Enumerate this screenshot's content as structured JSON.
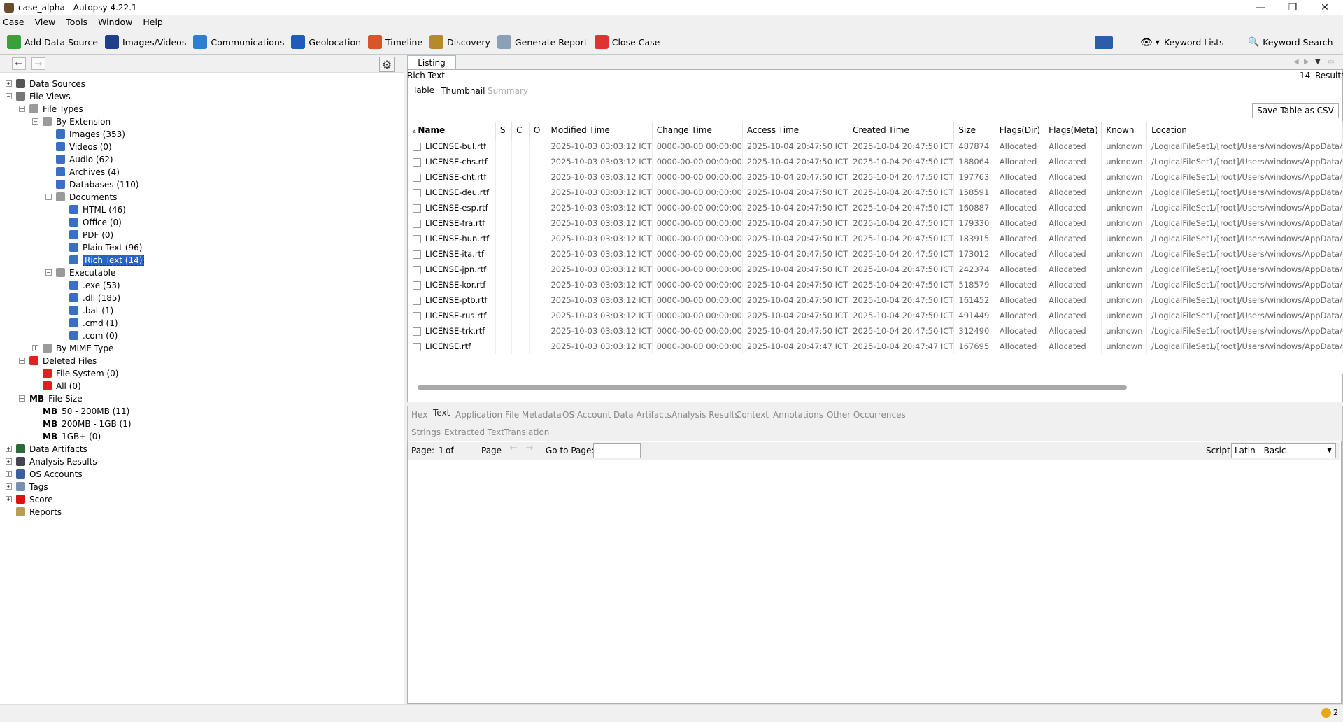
{
  "window": {
    "title": "case_alpha - Autopsy 4.22.1",
    "minimize": "—",
    "maximize": "❐",
    "close": "✕"
  },
  "menu": [
    "Case",
    "View",
    "Tools",
    "Window",
    "Help"
  ],
  "toolbar": {
    "buttons": [
      {
        "label": "Add Data Source",
        "icon": "add-data-source-icon",
        "color": "#3aa03a"
      },
      {
        "label": "Images/Videos",
        "icon": "images-videos-icon",
        "color": "#1f3f8a"
      },
      {
        "label": "Communications",
        "icon": "communications-icon",
        "color": "#2e7fd1"
      },
      {
        "label": "Geolocation",
        "icon": "geolocation-icon",
        "color": "#1f5bbf"
      },
      {
        "label": "Timeline",
        "icon": "timeline-icon",
        "color": "#d9542b"
      },
      {
        "label": "Discovery",
        "icon": "discovery-icon",
        "color": "#b58a2c"
      },
      {
        "label": "Generate Report",
        "icon": "generate-report-icon",
        "color": "#8aa0b8"
      },
      {
        "label": "Close Case",
        "icon": "close-case-icon",
        "color": "#d33"
      }
    ],
    "keyword_lists": "Keyword Lists",
    "keyword_search": "Keyword Search"
  },
  "tree": [
    {
      "label": "Data Sources",
      "level": 0,
      "exp": "+",
      "icon": "data-sources-icon",
      "color": "#555"
    },
    {
      "label": "File Views",
      "level": 0,
      "exp": "−",
      "icon": "file-views-icon",
      "color": "#777"
    },
    {
      "label": "File Types",
      "level": 1,
      "exp": "−",
      "icon": "file-types-icon",
      "color": "#9a9a9a"
    },
    {
      "label": "By Extension",
      "level": 2,
      "exp": "−",
      "icon": "by-extension-icon",
      "color": "#9a9a9a"
    },
    {
      "label": "Images (353)",
      "level": 3,
      "exp": "",
      "icon": "images-icon",
      "color": "#3a6fc4"
    },
    {
      "label": "Videos (0)",
      "level": 3,
      "exp": "",
      "icon": "videos-icon",
      "color": "#3a6fc4"
    },
    {
      "label": "Audio (62)",
      "level": 3,
      "exp": "",
      "icon": "audio-icon",
      "color": "#3a6fc4"
    },
    {
      "label": "Archives (4)",
      "level": 3,
      "exp": "",
      "icon": "archives-icon",
      "color": "#3a6fc4"
    },
    {
      "label": "Databases (110)",
      "level": 3,
      "exp": "",
      "icon": "databases-icon",
      "color": "#3a6fc4"
    },
    {
      "label": "Documents",
      "level": 3,
      "exp": "−",
      "icon": "documents-icon",
      "color": "#9a9a9a"
    },
    {
      "label": "HTML (46)",
      "level": 4,
      "exp": "",
      "icon": "html-icon",
      "color": "#3a6fc4"
    },
    {
      "label": "Office (0)",
      "level": 4,
      "exp": "",
      "icon": "office-icon",
      "color": "#3a6fc4"
    },
    {
      "label": "PDF (0)",
      "level": 4,
      "exp": "",
      "icon": "pdf-icon",
      "color": "#3a6fc4"
    },
    {
      "label": "Plain Text (96)",
      "level": 4,
      "exp": "",
      "icon": "plain-text-icon",
      "color": "#3a6fc4"
    },
    {
      "label": "Rich Text (14)",
      "level": 4,
      "exp": "",
      "icon": "rich-text-icon",
      "color": "#3a6fc4",
      "selected": true
    },
    {
      "label": "Executable",
      "level": 3,
      "exp": "−",
      "icon": "executable-icon",
      "color": "#9a9a9a"
    },
    {
      "label": ".exe (53)",
      "level": 4,
      "exp": "",
      "icon": "exe-icon",
      "color": "#3a6fc4"
    },
    {
      "label": ".dll (185)",
      "level": 4,
      "exp": "",
      "icon": "dll-icon",
      "color": "#3a6fc4"
    },
    {
      "label": ".bat (1)",
      "level": 4,
      "exp": "",
      "icon": "bat-icon",
      "color": "#3a6fc4"
    },
    {
      "label": ".cmd (1)",
      "level": 4,
      "exp": "",
      "icon": "cmd-icon",
      "color": "#3a6fc4"
    },
    {
      "label": ".com (0)",
      "level": 4,
      "exp": "",
      "icon": "com-icon",
      "color": "#3a6fc4"
    },
    {
      "label": "By MIME Type",
      "level": 2,
      "exp": "+",
      "icon": "by-mime-type-icon",
      "color": "#9a9a9a"
    },
    {
      "label": "Deleted Files",
      "level": 1,
      "exp": "−",
      "icon": "deleted-files-icon",
      "color": "#d22"
    },
    {
      "label": "File System (0)",
      "level": 2,
      "exp": "",
      "icon": "deleted-file-system-icon",
      "color": "#d22"
    },
    {
      "label": "All (0)",
      "level": 2,
      "exp": "",
      "icon": "deleted-all-icon",
      "color": "#d22"
    },
    {
      "label": "File Size",
      "level": 1,
      "exp": "−",
      "icon": "file-size-icon",
      "mb": true
    },
    {
      "label": "50 - 200MB (11)",
      "level": 2,
      "exp": "",
      "icon": "size-50-200-icon",
      "mb": true
    },
    {
      "label": "200MB - 1GB (1)",
      "level": 2,
      "exp": "",
      "icon": "size-200-1gb-icon",
      "mb": true
    },
    {
      "label": "1GB+ (0)",
      "level": 2,
      "exp": "",
      "icon": "size-1gb-icon",
      "mb": true
    },
    {
      "label": "Data Artifacts",
      "level": 0,
      "exp": "+",
      "icon": "data-artifacts-icon",
      "color": "#2a6a3a"
    },
    {
      "label": "Analysis Results",
      "level": 0,
      "exp": "+",
      "icon": "analysis-results-icon",
      "color": "#445"
    },
    {
      "label": "OS Accounts",
      "level": 0,
      "exp": "+",
      "icon": "os-accounts-icon",
      "color": "#3a5fa0"
    },
    {
      "label": "Tags",
      "level": 0,
      "exp": "+",
      "icon": "tags-icon",
      "color": "#7a8fb0"
    },
    {
      "label": "Score",
      "level": 0,
      "exp": "+",
      "icon": "score-icon",
      "color": "#d11"
    },
    {
      "label": "Reports",
      "level": 0,
      "exp": "",
      "icon": "reports-icon",
      "color": "#b8a048"
    }
  ],
  "mb_label": "MB",
  "listing": {
    "tab": "Listing",
    "header": "Rich Text",
    "results_count": "14",
    "results_label": "Results",
    "subtabs": [
      "Table",
      "Thumbnail",
      "Summary"
    ],
    "save_csv": "Save Table as CSV",
    "columns": [
      "Name",
      "S",
      "C",
      "O",
      "Modified Time",
      "Change Time",
      "Access Time",
      "Created Time",
      "Size",
      "Flags(Dir)",
      "Flags(Meta)",
      "Known",
      "Location"
    ],
    "rows": [
      [
        "LICENSE-bul.rtf",
        "",
        "",
        "",
        "2025-10-03 03:03:12 ICT",
        "0000-00-00 00:00:00",
        "2025-10-04 20:47:50 ICT",
        "2025-10-04 20:47:50 ICT",
        "487874",
        "Allocated",
        "Allocated",
        "unknown",
        "/LogicalFileSet1/[root]/Users/windows/AppData/"
      ],
      [
        "LICENSE-chs.rtf",
        "",
        "",
        "",
        "2025-10-03 03:03:12 ICT",
        "0000-00-00 00:00:00",
        "2025-10-04 20:47:50 ICT",
        "2025-10-04 20:47:50 ICT",
        "188064",
        "Allocated",
        "Allocated",
        "unknown",
        "/LogicalFileSet1/[root]/Users/windows/AppData/"
      ],
      [
        "LICENSE-cht.rtf",
        "",
        "",
        "",
        "2025-10-03 03:03:12 ICT",
        "0000-00-00 00:00:00",
        "2025-10-04 20:47:50 ICT",
        "2025-10-04 20:47:50 ICT",
        "197763",
        "Allocated",
        "Allocated",
        "unknown",
        "/LogicalFileSet1/[root]/Users/windows/AppData/"
      ],
      [
        "LICENSE-deu.rtf",
        "",
        "",
        "",
        "2025-10-03 03:03:12 ICT",
        "0000-00-00 00:00:00",
        "2025-10-04 20:47:50 ICT",
        "2025-10-04 20:47:50 ICT",
        "158591",
        "Allocated",
        "Allocated",
        "unknown",
        "/LogicalFileSet1/[root]/Users/windows/AppData/"
      ],
      [
        "LICENSE-esp.rtf",
        "",
        "",
        "",
        "2025-10-03 03:03:12 ICT",
        "0000-00-00 00:00:00",
        "2025-10-04 20:47:50 ICT",
        "2025-10-04 20:47:50 ICT",
        "160887",
        "Allocated",
        "Allocated",
        "unknown",
        "/LogicalFileSet1/[root]/Users/windows/AppData/"
      ],
      [
        "LICENSE-fra.rtf",
        "",
        "",
        "",
        "2025-10-03 03:03:12 ICT",
        "0000-00-00 00:00:00",
        "2025-10-04 20:47:50 ICT",
        "2025-10-04 20:47:50 ICT",
        "179330",
        "Allocated",
        "Allocated",
        "unknown",
        "/LogicalFileSet1/[root]/Users/windows/AppData/"
      ],
      [
        "LICENSE-hun.rtf",
        "",
        "",
        "",
        "2025-10-03 03:03:12 ICT",
        "0000-00-00 00:00:00",
        "2025-10-04 20:47:50 ICT",
        "2025-10-04 20:47:50 ICT",
        "183915",
        "Allocated",
        "Allocated",
        "unknown",
        "/LogicalFileSet1/[root]/Users/windows/AppData/"
      ],
      [
        "LICENSE-ita.rtf",
        "",
        "",
        "",
        "2025-10-03 03:03:12 ICT",
        "0000-00-00 00:00:00",
        "2025-10-04 20:47:50 ICT",
        "2025-10-04 20:47:50 ICT",
        "173012",
        "Allocated",
        "Allocated",
        "unknown",
        "/LogicalFileSet1/[root]/Users/windows/AppData/"
      ],
      [
        "LICENSE-jpn.rtf",
        "",
        "",
        "",
        "2025-10-03 03:03:12 ICT",
        "0000-00-00 00:00:00",
        "2025-10-04 20:47:50 ICT",
        "2025-10-04 20:47:50 ICT",
        "242374",
        "Allocated",
        "Allocated",
        "unknown",
        "/LogicalFileSet1/[root]/Users/windows/AppData/"
      ],
      [
        "LICENSE-kor.rtf",
        "",
        "",
        "",
        "2025-10-03 03:03:12 ICT",
        "0000-00-00 00:00:00",
        "2025-10-04 20:47:50 ICT",
        "2025-10-04 20:47:50 ICT",
        "518579",
        "Allocated",
        "Allocated",
        "unknown",
        "/LogicalFileSet1/[root]/Users/windows/AppData/"
      ],
      [
        "LICENSE-ptb.rtf",
        "",
        "",
        "",
        "2025-10-03 03:03:12 ICT",
        "0000-00-00 00:00:00",
        "2025-10-04 20:47:50 ICT",
        "2025-10-04 20:47:50 ICT",
        "161452",
        "Allocated",
        "Allocated",
        "unknown",
        "/LogicalFileSet1/[root]/Users/windows/AppData/"
      ],
      [
        "LICENSE-rus.rtf",
        "",
        "",
        "",
        "2025-10-03 03:03:12 ICT",
        "0000-00-00 00:00:00",
        "2025-10-04 20:47:50 ICT",
        "2025-10-04 20:47:50 ICT",
        "491449",
        "Allocated",
        "Allocated",
        "unknown",
        "/LogicalFileSet1/[root]/Users/windows/AppData/"
      ],
      [
        "LICENSE-trk.rtf",
        "",
        "",
        "",
        "2025-10-03 03:03:12 ICT",
        "0000-00-00 00:00:00",
        "2025-10-04 20:47:50 ICT",
        "2025-10-04 20:47:50 ICT",
        "312490",
        "Allocated",
        "Allocated",
        "unknown",
        "/LogicalFileSet1/[root]/Users/windows/AppData/"
      ],
      [
        "LICENSE.rtf",
        "",
        "",
        "",
        "2025-10-03 03:03:12 ICT",
        "0000-00-00 00:00:00",
        "2025-10-04 20:47:47 ICT",
        "2025-10-04 20:47:47 ICT",
        "167695",
        "Allocated",
        "Allocated",
        "unknown",
        "/LogicalFileSet1/[root]/Users/windows/AppData/"
      ]
    ]
  },
  "content_viewer": {
    "tabs": [
      "Hex",
      "Text",
      "Application",
      "File Metadata",
      "OS Account",
      "Data Artifacts",
      "Analysis Results",
      "Context",
      "Annotations",
      "Other Occurrences"
    ],
    "subtabs": [
      "Strings",
      "Extracted Text",
      "Translation"
    ],
    "page_label": "Page:",
    "page_value": "1",
    "page_of": "of",
    "page_word": "Page",
    "goto_label": "Go to Page:",
    "goto_value": "",
    "script_label": "Script:",
    "script_value": "Latin - Basic"
  },
  "statusbar": {
    "notifications": "2"
  }
}
